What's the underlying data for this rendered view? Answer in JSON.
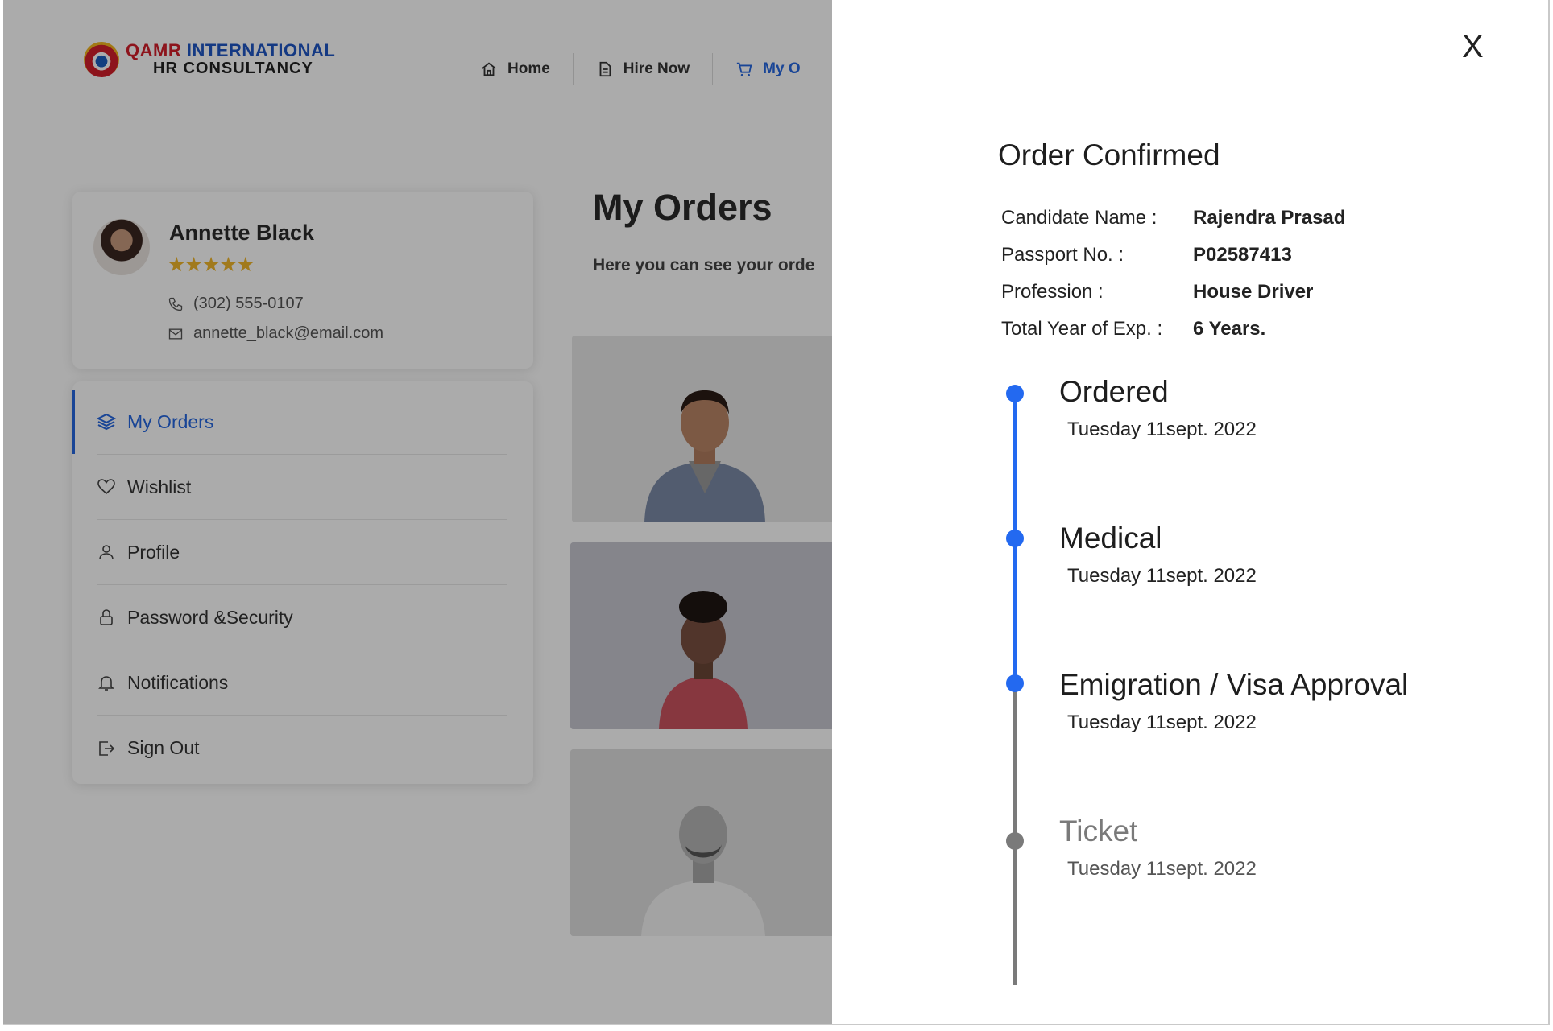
{
  "brand": {
    "line1_part1": "QAMR",
    "line1_part2": "INTERNATIONAL",
    "line2": "HR CONSULTANCY"
  },
  "nav": {
    "items": [
      {
        "label": "Home",
        "icon": "home-icon"
      },
      {
        "label": "Hire Now",
        "icon": "document-icon"
      },
      {
        "label": "My O",
        "icon": "cart-icon"
      }
    ]
  },
  "profile": {
    "name": "Annette Black",
    "rating": "★★★★★",
    "phone": "(302) 555-0107",
    "email": "annette_black@email.com"
  },
  "menu": {
    "items": [
      {
        "label": "My Orders",
        "icon": "layers-icon"
      },
      {
        "label": "Wishlist",
        "icon": "heart-icon"
      },
      {
        "label": "Profile",
        "icon": "user-icon"
      },
      {
        "label": "Password &Security",
        "icon": "lock-icon"
      },
      {
        "label": "Notifications",
        "icon": "bell-icon"
      },
      {
        "label": "Sign Out",
        "icon": "sign-out-icon"
      }
    ]
  },
  "orders": {
    "title": "My Orders",
    "subtitle": "Here you can see your orde"
  },
  "drawer": {
    "close": "X",
    "title": "Order Confirmed",
    "details": [
      {
        "label": "Candidate Name :",
        "value": "Rajendra Prasad"
      },
      {
        "label": "Passport No. :",
        "value": "P02587413"
      },
      {
        "label": "Profession :",
        "value": "House Driver"
      },
      {
        "label": "Total Year of Exp. :",
        "value": "6 Years."
      }
    ],
    "timeline": [
      {
        "title": "Ordered",
        "date": "Tuesday 11sept. 2022",
        "status": "done"
      },
      {
        "title": "Medical",
        "date": "Tuesday 11sept. 2022",
        "status": "done"
      },
      {
        "title": "Emigration / Visa Approval",
        "date": "Tuesday 11sept. 2022",
        "status": "current"
      },
      {
        "title": "Ticket",
        "date": "Tuesday 11sept. 2022",
        "status": "pending"
      }
    ]
  },
  "colors": {
    "accent": "#2369f0",
    "pending": "#7a7a7a",
    "overlay": "rgba(0,0,0,0.33)"
  }
}
